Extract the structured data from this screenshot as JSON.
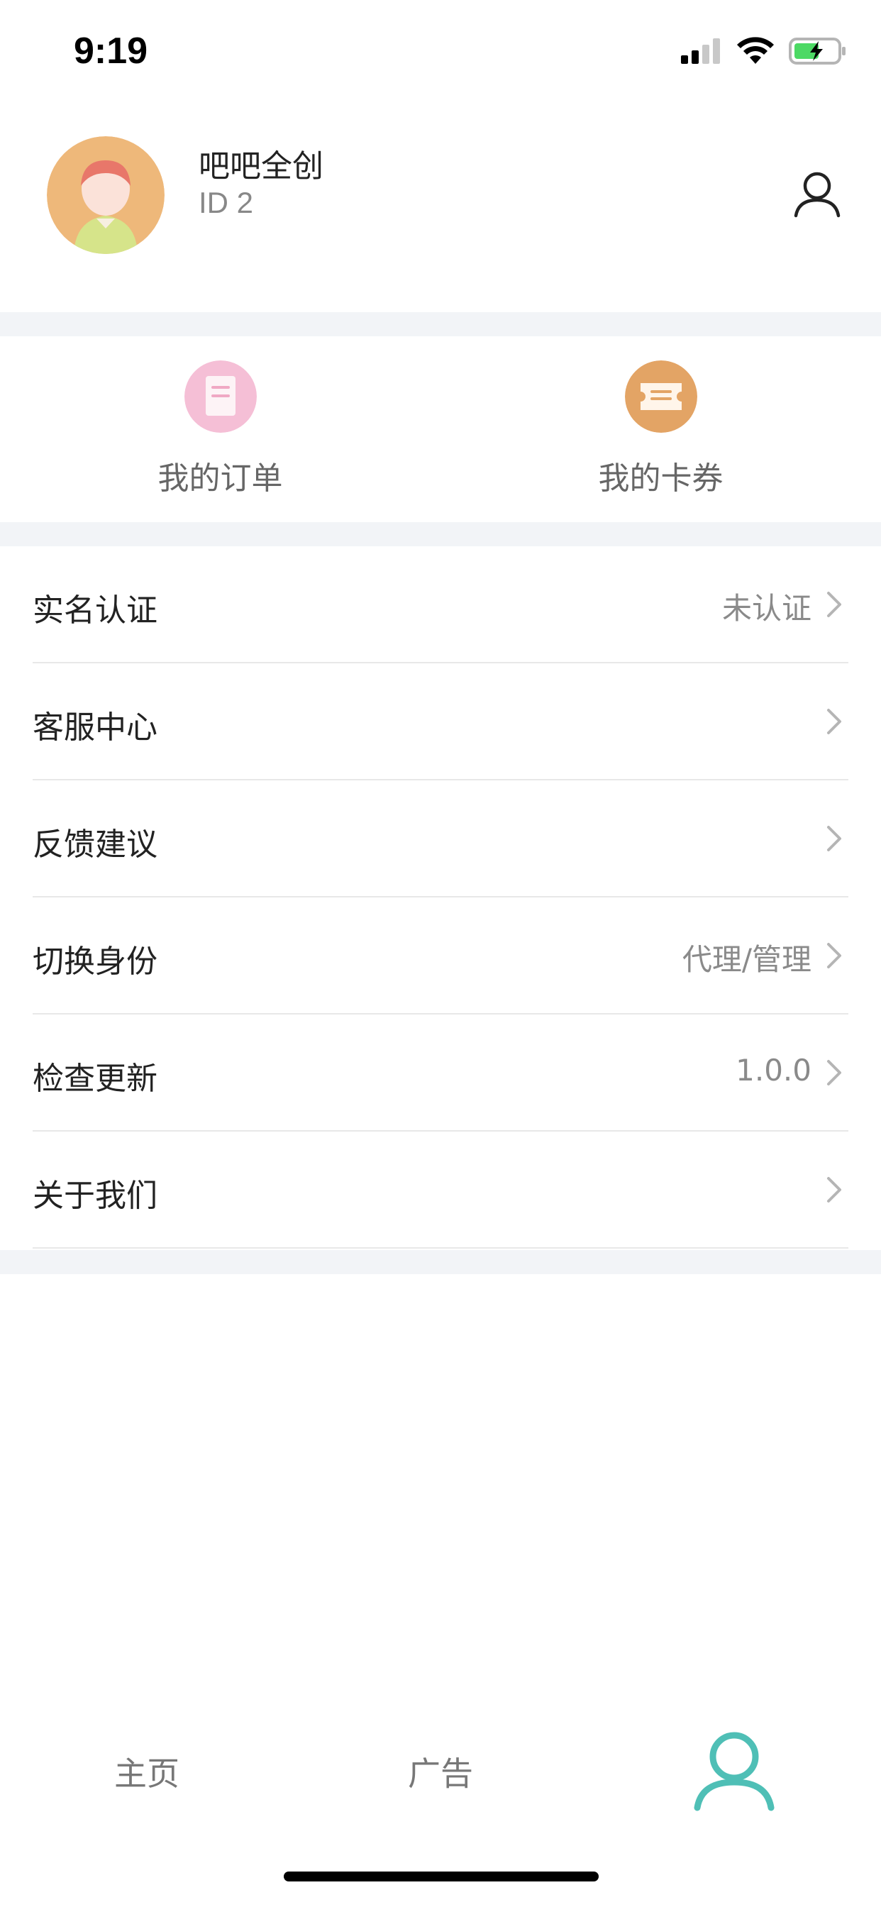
{
  "status_bar": {
    "time": "9:19"
  },
  "profile": {
    "name": "吧吧全创",
    "id": "ID 2"
  },
  "quick_actions": [
    {
      "label": "我的订单",
      "icon": "order-document-icon",
      "color": "#f5bfd6"
    },
    {
      "label": "我的卡券",
      "icon": "coupon-ticket-icon",
      "color": "#e3a465"
    }
  ],
  "menu": [
    {
      "label": "实名认证",
      "value": "未认证"
    },
    {
      "label": "客服中心",
      "value": ""
    },
    {
      "label": "反馈建议",
      "value": ""
    },
    {
      "label": "切换身份",
      "value": "代理/管理"
    },
    {
      "label": "检查更新",
      "value": "1.0.0"
    },
    {
      "label": "关于我们",
      "value": ""
    }
  ],
  "tabbar": {
    "home": "主页",
    "ads": "广告",
    "profile_icon": "person-icon",
    "active_color": "#4fbfb6"
  },
  "colors": {
    "band": "#f2f4f7",
    "avatar_bg": "#eeb87a"
  }
}
